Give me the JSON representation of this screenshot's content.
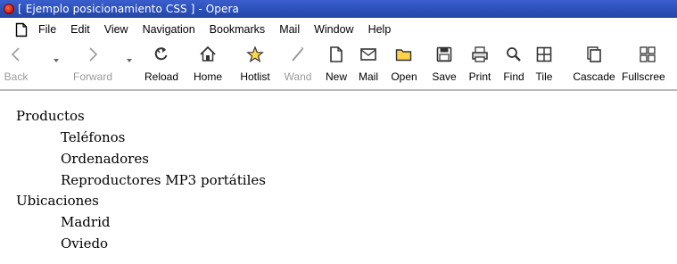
{
  "window": {
    "title": "[ Ejemplo posicionamiento CSS ] - Opera"
  },
  "menubar": {
    "items": [
      "File",
      "Edit",
      "View",
      "Navigation",
      "Bookmarks",
      "Mail",
      "Window",
      "Help"
    ]
  },
  "toolbar": {
    "buttons": [
      {
        "label": "Back",
        "icon": "back-arrow-icon",
        "enabled": false
      },
      {
        "label": "Forward",
        "icon": "forward-arrow-icon",
        "enabled": false
      },
      {
        "label": "Reload",
        "icon": "reload-icon",
        "enabled": true
      },
      {
        "label": "Home",
        "icon": "home-icon",
        "enabled": true
      },
      {
        "label": "Hotlist",
        "icon": "star-icon",
        "enabled": true
      },
      {
        "label": "Wand",
        "icon": "wand-icon",
        "enabled": false
      },
      {
        "label": "New",
        "icon": "new-page-icon",
        "enabled": true
      },
      {
        "label": "Mail",
        "icon": "envelope-icon",
        "enabled": true
      },
      {
        "label": "Open",
        "icon": "folder-icon",
        "enabled": true
      },
      {
        "label": "Save",
        "icon": "floppy-disk-icon",
        "enabled": true
      },
      {
        "label": "Print",
        "icon": "printer-icon",
        "enabled": true
      },
      {
        "label": "Find",
        "icon": "magnifier-icon",
        "enabled": true
      },
      {
        "label": "Tile",
        "icon": "tile-icon",
        "enabled": true
      },
      {
        "label": "Cascade",
        "icon": "cascade-icon",
        "enabled": true
      },
      {
        "label": "Fullscree",
        "icon": "fullscreen-icon",
        "enabled": true
      }
    ]
  },
  "content": {
    "sections": [
      {
        "title": "Productos",
        "items": [
          "Teléfonos",
          "Ordenadores",
          "Reproductores MP3 portátiles"
        ]
      },
      {
        "title": "Ubicaciones",
        "items": [
          "Madrid",
          "Oviedo"
        ]
      }
    ]
  }
}
